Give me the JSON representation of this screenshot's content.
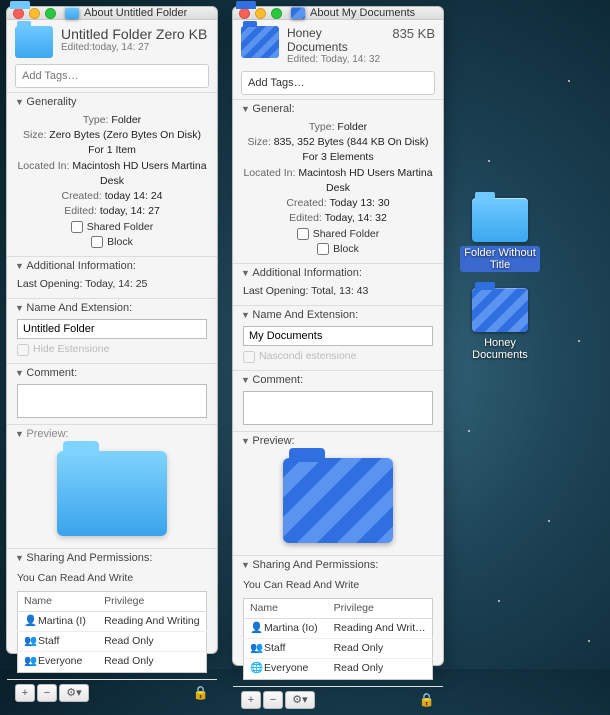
{
  "desktop": {
    "items": [
      {
        "label": "Folder Without Title",
        "kind": "blue",
        "selected": true
      },
      {
        "label": "Honey Documents",
        "kind": "striped",
        "selected": false
      }
    ]
  },
  "windows": [
    {
      "id": "win1",
      "title": "About Untitled Folder",
      "icon_kind": "blue",
      "header_title": "Untitled Folder Zero KB",
      "header_sub": "Edited:today, 14: 27",
      "header_size": "",
      "tags_placeholder": "Add Tags…",
      "general": {
        "label": "Generality",
        "type_k": "Type:",
        "type_v": "Folder",
        "size_k": "Size:",
        "size_v": "Zero Bytes (Zero Bytes On Disk) For 1 Item",
        "loc_k": "Located In:",
        "loc_v": "Macintosh HD Users Martina Desk",
        "created_k": "Created:",
        "created_v": "today 14: 24",
        "edited_k": "Edited:",
        "edited_v": "today, 14: 27",
        "shared_label": "Shared Folder",
        "block_label": "Block"
      },
      "additional": {
        "label": "Additional Information:",
        "last_open_k": "Last Opening:",
        "last_open_v": "Today, 14: 25"
      },
      "name_ext": {
        "label": "Name And Extension:",
        "value": "Untitled Folder",
        "hide_label": "Hide Estensione"
      },
      "comment": {
        "label": "Comment:"
      },
      "preview": {
        "label": "Preview:",
        "kind": "blue"
      },
      "sharing": {
        "label": "Sharing And Permissions:",
        "note": "You Can Read And Write",
        "col_name": "Name",
        "col_priv": "Privilege",
        "rows": [
          {
            "icon": "👤",
            "name": "Martina (I)",
            "priv": "Reading And Writing"
          },
          {
            "icon": "👥",
            "name": "Staff",
            "priv": "Read Only"
          },
          {
            "icon": "👥",
            "name": "Everyone",
            "priv": "Read Only"
          }
        ]
      },
      "footer": {
        "add": "+",
        "remove": "−",
        "gear": "⚙▾",
        "lock": "🔒"
      }
    },
    {
      "id": "win2",
      "title": "About My Documents",
      "icon_kind": "striped",
      "header_title": "Honey Documents",
      "header_sub": "Edited: Today, 14: 32",
      "header_size": "835 KB",
      "tags_placeholder": "Add Tags…",
      "general": {
        "label": "General:",
        "type_k": "Type:",
        "type_v": "Folder",
        "size_k": "Size:",
        "size_v": "835, 352 Bytes (844 KB On Disk) For 3 Elements",
        "loc_k": "Located In:",
        "loc_v": "Macintosh HD Users Martina Desk",
        "created_k": "Created:",
        "created_v": "Today 13: 30",
        "edited_k": "Edited:",
        "edited_v": "Today, 14: 32",
        "shared_label": "Shared Folder",
        "block_label": "Block"
      },
      "additional": {
        "label": "Additional Information:",
        "last_open_k": "Last Opening:",
        "last_open_v": "Total, 13: 43"
      },
      "name_ext": {
        "label": "Name And Extension:",
        "value": "My Documents",
        "hide_label": "Nascondi estensione"
      },
      "comment": {
        "label": "Comment:"
      },
      "preview": {
        "label": "Preview:",
        "kind": "striped"
      },
      "sharing": {
        "label": "Sharing And Permissions:",
        "note": "You Can Read And Write",
        "col_name": "Name",
        "col_priv": "Privilege",
        "rows": [
          {
            "icon": "👤",
            "name": "Martina (Io)",
            "priv": "Reading And Writing"
          },
          {
            "icon": "👥",
            "name": "Staff",
            "priv": "Read Only"
          },
          {
            "icon": "🌐",
            "name": "Everyone",
            "priv": "Read Only"
          }
        ]
      },
      "footer": {
        "add": "+",
        "remove": "−",
        "gear": "⚙▾",
        "lock": "🔒"
      }
    }
  ]
}
